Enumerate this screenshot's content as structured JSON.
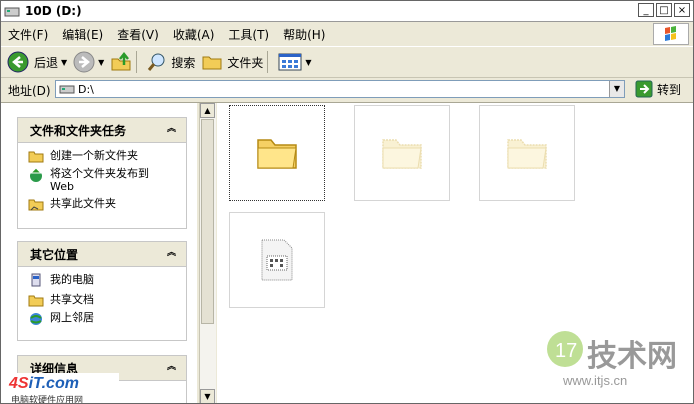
{
  "window": {
    "title": "10D (D:)"
  },
  "menu": [
    "文件(F)",
    "编辑(E)",
    "查看(V)",
    "收藏(A)",
    "工具(T)",
    "帮助(H)"
  ],
  "toolbar": {
    "back": "后退",
    "search": "搜索",
    "folders": "文件夹"
  },
  "address": {
    "label": "地址(D)",
    "value": "D:\\",
    "go": "转到"
  },
  "panels": {
    "tasks": {
      "title": "文件和文件夹任务",
      "items": [
        "创建一个新文件夹",
        "将这个文件夹发布到",
        "Web",
        "共享此文件夹"
      ]
    },
    "places": {
      "title": "其它位置",
      "items": [
        "我的电脑",
        "共享文档",
        "网上邻居"
      ]
    },
    "details": {
      "title": "详细信息"
    }
  },
  "watermarks": {
    "left_logo_a": "4S",
    "left_logo_b": "iT",
    "left_logo_c": ".com",
    "left_sub": "电脑软硬件应用网",
    "right_cn": "技术网",
    "right_url": "www.itjs.cn"
  }
}
